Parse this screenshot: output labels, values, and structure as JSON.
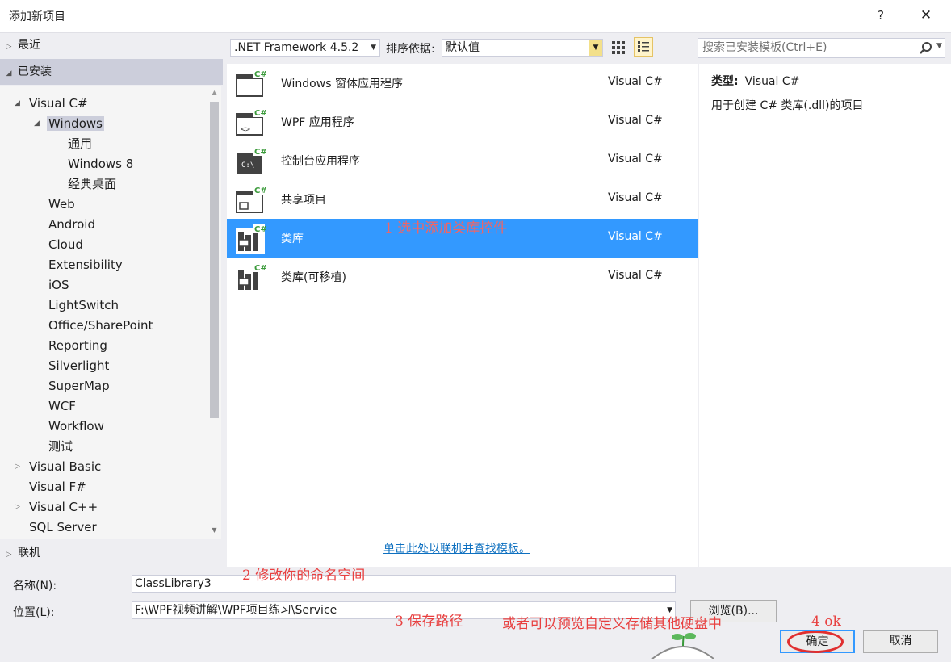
{
  "window": {
    "title": "添加新项目",
    "help": "?",
    "close": "✕"
  },
  "categories": {
    "recent": "最近",
    "installed": "已安装",
    "online": "联机"
  },
  "tree": {
    "visual_csharp": "Visual C#",
    "windows": "Windows",
    "general": "通用",
    "windows8": "Windows 8",
    "classic_desktop": "经典桌面",
    "web": "Web",
    "android": "Android",
    "cloud": "Cloud",
    "extensibility": "Extensibility",
    "ios": "iOS",
    "lightswitch": "LightSwitch",
    "office_sharepoint": "Office/SharePoint",
    "reporting": "Reporting",
    "silverlight": "Silverlight",
    "supermap": "SuperMap",
    "wcf": "WCF",
    "workflow": "Workflow",
    "test": "测试",
    "visual_basic": "Visual Basic",
    "visual_fsharp": "Visual F#",
    "visual_cpp": "Visual C++",
    "sql_server": "SQL Server"
  },
  "toolbar": {
    "framework": ".NET Framework 4.5.2",
    "sort_label": "排序依据:",
    "sort_value": "默认值",
    "search_placeholder": "搜索已安装模板(Ctrl+E)"
  },
  "templates": [
    {
      "name": "Windows 窗体应用程序",
      "lang": "Visual C#"
    },
    {
      "name": "WPF 应用程序",
      "lang": "Visual C#"
    },
    {
      "name": "控制台应用程序",
      "lang": "Visual C#"
    },
    {
      "name": "共享项目",
      "lang": "Visual C#"
    },
    {
      "name": "类库",
      "lang": "Visual C#"
    },
    {
      "name": "类库(可移植)",
      "lang": "Visual C#"
    }
  ],
  "online_link": "单击此处以联机并查找模板。",
  "details": {
    "type_label": "类型:",
    "type_value": "Visual C#",
    "description": "用于创建 C# 类库(.dll)的项目"
  },
  "form": {
    "name_label": "名称(N):",
    "name_value": "ClassLibrary3",
    "location_label": "位置(L):",
    "location_value": "F:\\WPF视频讲解\\WPF项目练习\\Service",
    "browse": "浏览(B)...",
    "ok": "确定",
    "cancel": "取消"
  },
  "annotations": {
    "note1": "1 选中添加类库控件",
    "note2": "2 修改你的命名空间",
    "note3": "3 保存路径",
    "note3b": "或者可以预览自定义存储其他硬盘中",
    "note4": "4 ok"
  },
  "colors": {
    "selection": "#3399ff",
    "annotation": "#e84040",
    "accent_csharp": "#3a9a3a"
  }
}
